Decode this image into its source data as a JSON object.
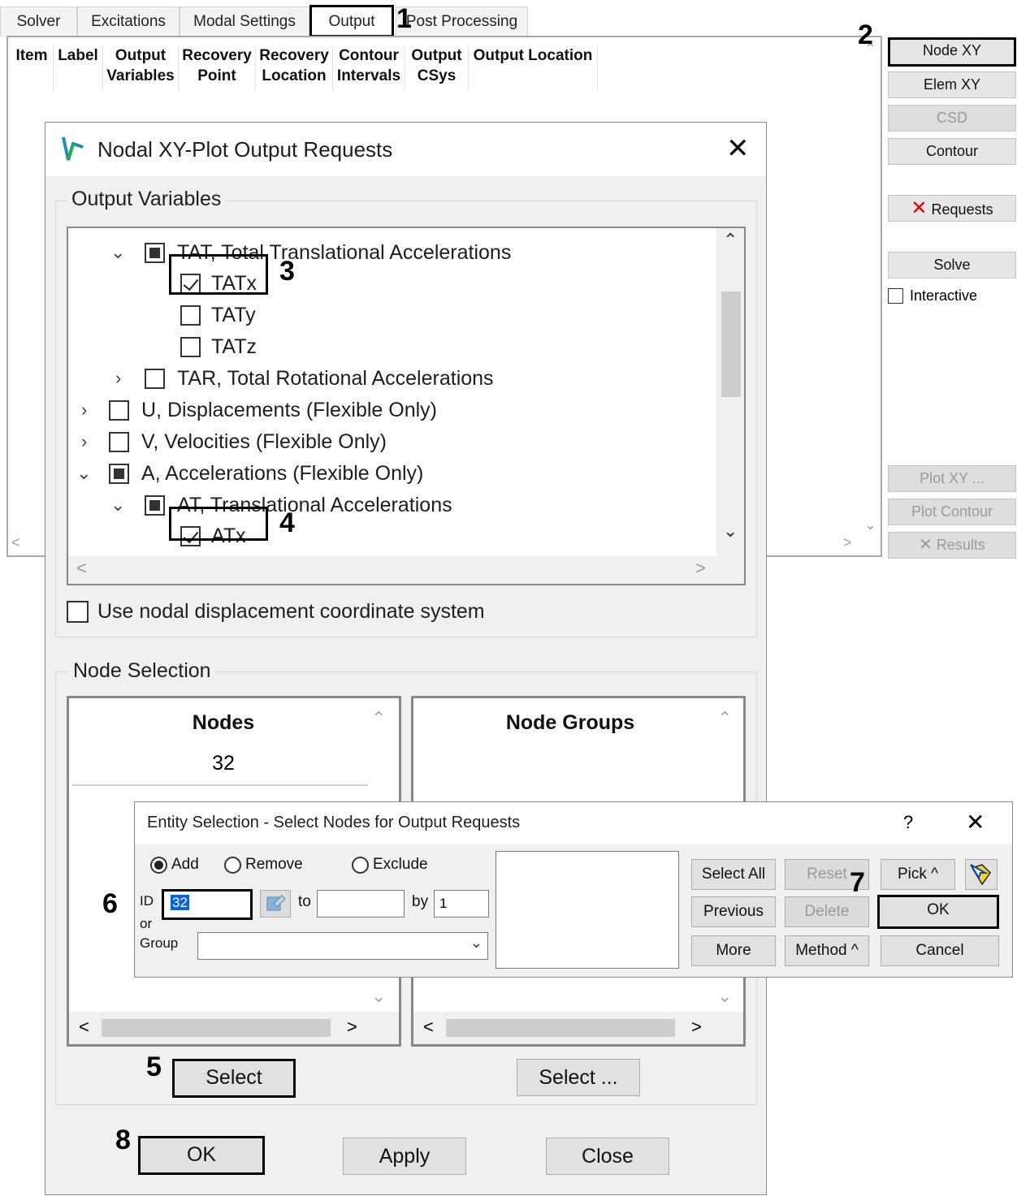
{
  "tabs": [
    "Solver",
    "Excitations",
    "Modal Settings",
    "Output",
    "Post Processing"
  ],
  "columns": [
    {
      "line1": "Item",
      "line2": ""
    },
    {
      "line1": "Label",
      "line2": ""
    },
    {
      "line1": "Output",
      "line2": "Variables"
    },
    {
      "line1": "Recovery",
      "line2": "Point"
    },
    {
      "line1": "Recovery",
      "line2": "Location"
    },
    {
      "line1": "Contour",
      "line2": "Intervals"
    },
    {
      "line1": "Output",
      "line2": "CSys"
    },
    {
      "line1": "Output Location",
      "line2": ""
    }
  ],
  "side_buttons": {
    "node_xy": "Node XY",
    "elem_xy": "Elem XY",
    "csd": "CSD",
    "contour": "Contour",
    "requests": "Requests",
    "solve": "Solve",
    "interactive": "Interactive",
    "plot_xy": "Plot XY ...",
    "plot_contour": "Plot Contour",
    "results": "Results"
  },
  "callouts": [
    "1",
    "2",
    "3",
    "4",
    "5",
    "6",
    "7",
    "8"
  ],
  "nodal_dialog": {
    "title": "Nodal XY-Plot Output Requests",
    "output_variables_legend": "Output Variables",
    "tree": {
      "tat": "TAT, Total Translational Accelerations",
      "tatx": "TATx",
      "taty": "TATy",
      "tatz": "TATz",
      "tar": "TAR, Total Rotational Accelerations",
      "u": "U, Displacements (Flexible Only)",
      "v": "V, Velocities (Flexible Only)",
      "a": "A, Accelerations (Flexible Only)",
      "at": "AT, Translational Accelerations",
      "atx": "ATx",
      "aty_partial": "AT"
    },
    "use_nodal_cs": "Use nodal displacement coordinate system",
    "node_selection_legend": "Node Selection",
    "nodes_header": "Nodes",
    "nodes": [
      "32"
    ],
    "node_groups_header": "Node Groups",
    "select_nodes": "Select",
    "select_groups": "Select ...",
    "ok": "OK",
    "apply": "Apply",
    "close": "Close"
  },
  "entity_dialog": {
    "title": "Entity Selection - Select Nodes for Output Requests",
    "help": "?",
    "add": "Add",
    "remove": "Remove",
    "exclude": "Exclude",
    "id_label": "ID",
    "or_label": "or",
    "group_label": "Group",
    "id_value": "32",
    "to_label": "to",
    "by_label": "by",
    "by_value": "1",
    "select_all": "Select All",
    "reset": "Reset",
    "pick": "Pick ^",
    "previous": "Previous",
    "delete": "Delete",
    "ok": "OK",
    "more": "More",
    "method": "Method ^",
    "cancel": "Cancel"
  }
}
